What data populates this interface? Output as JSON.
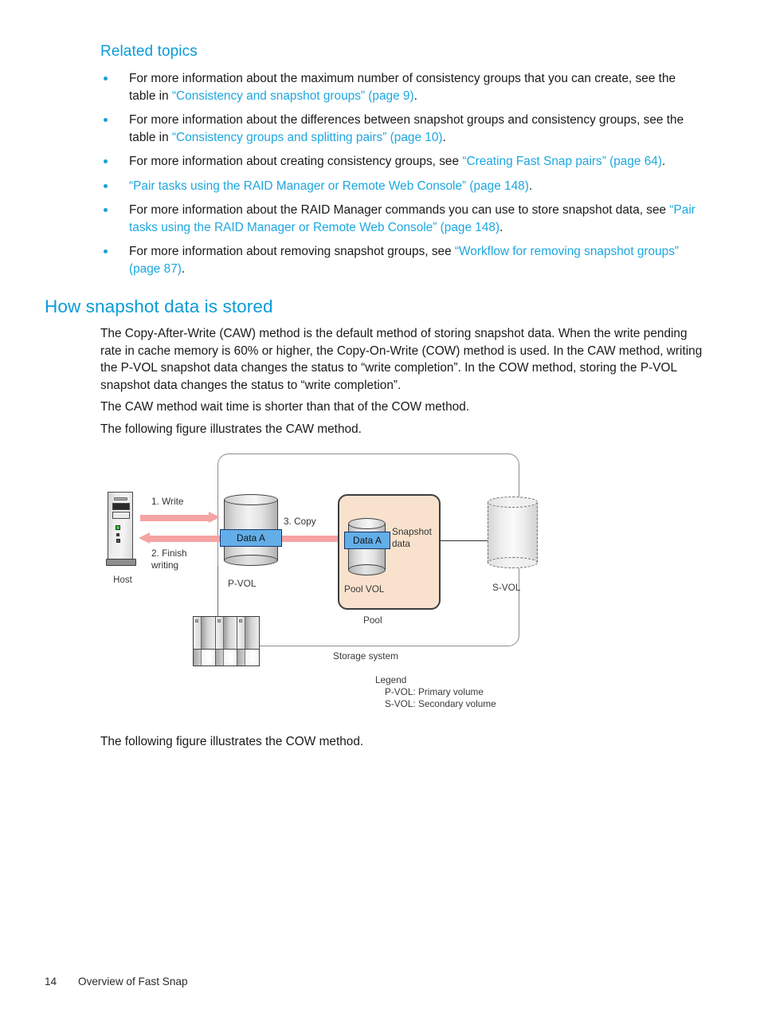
{
  "headings": {
    "related_topics": "Related topics",
    "section": "How snapshot data is stored"
  },
  "bullets": [
    {
      "parts": [
        {
          "t": "For more information about the maximum number of consistency groups that you can create, see the table in ",
          "link": false
        },
        {
          "t": "“Consistency and snapshot groups” (page 9)",
          "link": true
        },
        {
          "t": ".",
          "link": false
        }
      ]
    },
    {
      "parts": [
        {
          "t": "For more information about the differences between snapshot groups and consistency groups, see the table in ",
          "link": false
        },
        {
          "t": "“Consistency groups and splitting pairs” (page 10)",
          "link": true
        },
        {
          "t": ".",
          "link": false
        }
      ]
    },
    {
      "parts": [
        {
          "t": "For more information about creating consistency groups, see ",
          "link": false
        },
        {
          "t": "“Creating Fast Snap pairs” (page 64)",
          "link": true
        },
        {
          "t": ".",
          "link": false
        }
      ]
    },
    {
      "parts": [
        {
          "t": "“Pair tasks using the RAID Manager or Remote Web Console” (page 148)",
          "link": true
        },
        {
          "t": ".",
          "link": false
        }
      ]
    },
    {
      "parts": [
        {
          "t": "For more information about the RAID Manager commands you can use to store snapshot data, see ",
          "link": false
        },
        {
          "t": "“Pair tasks using the RAID Manager or Remote Web Console” (page 148)",
          "link": true
        },
        {
          "t": ".",
          "link": false
        }
      ]
    },
    {
      "parts": [
        {
          "t": "For more information about removing snapshot groups, see ",
          "link": false
        },
        {
          "t": "“Workflow for removing snapshot groups” (page 87)",
          "link": true
        },
        {
          "t": ".",
          "link": false
        }
      ]
    }
  ],
  "paragraphs": {
    "p1": "The Copy-After-Write (CAW) method is the default method of storing snapshot data. When the write pending rate in cache memory is 60% or higher, the Copy-On-Write (COW) method is used. In the CAW method, writing the P-VOL snapshot data changes the status to “write completion”. In the COW method, storing the P-VOL snapshot data changes the status to “write completion”.",
    "p2": "The CAW method wait time is shorter than that of the COW method.",
    "p3": "The following figure illustrates the CAW method.",
    "p4": "The following figure illustrates the COW method."
  },
  "figure": {
    "host_label": "Host",
    "arrow_write": "1. Write",
    "arrow_finish": "2. Finish writing",
    "arrow_copy": "3. Copy",
    "pvol_label": "P-VOL",
    "pvol_data": "Data A",
    "pool_vol_label": "Pool VOL",
    "pool_vol_data": "Data A",
    "snapshot_data_label": "Snapshot data",
    "pool_caption": "Pool",
    "svol_label": "S-VOL",
    "storage_caption": "Storage system",
    "legend_title": "Legend",
    "legend_pvol": "P-VOL: Primary volume",
    "legend_svol": "S-VOL: Secondary volume"
  },
  "footer": {
    "page_number": "14",
    "chapter": "Overview of Fast Snap"
  },
  "colors": {
    "heading": "#0a9bd8",
    "link": "#1ca7e0",
    "arrow": "#f5a3a3",
    "data_band": "#63aee8",
    "pool_fill": "#f9e2cd",
    "text": "#1a1a1a"
  }
}
